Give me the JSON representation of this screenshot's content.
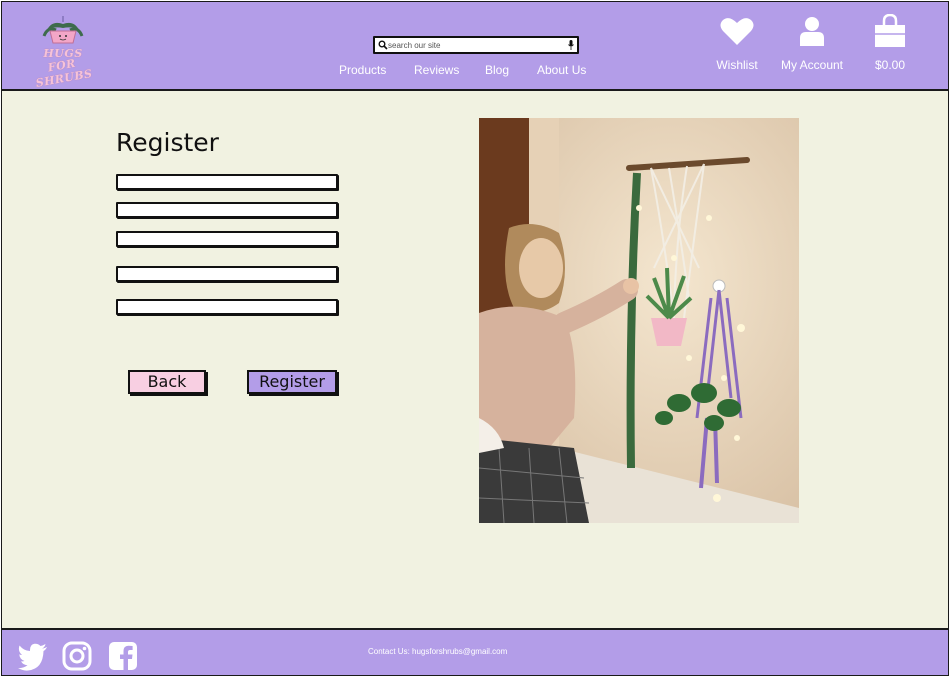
{
  "brand": {
    "logo_line1": "HUGS",
    "logo_line2": "FOR SHRUBS"
  },
  "search": {
    "placeholder": "search our site",
    "value": ""
  },
  "nav": [
    {
      "label": "Products"
    },
    {
      "label": "Reviews"
    },
    {
      "label": "Blog"
    },
    {
      "label": "About Us"
    }
  ],
  "header_actions": {
    "wishlist": "Wishlist",
    "account": "My Account",
    "cart_total": "$0.00"
  },
  "form": {
    "title": "Register",
    "fields": [
      "",
      "",
      "",
      "",
      ""
    ],
    "back_label": "Back",
    "register_label": "Register"
  },
  "footer": {
    "contact": "Contact Us: hugsforshrubs@gmail.com"
  },
  "colors": {
    "header": "#b39de8",
    "page_bg": "#f1f2e1",
    "back_btn": "#f8cfe2",
    "register_btn": "#b39de8"
  }
}
